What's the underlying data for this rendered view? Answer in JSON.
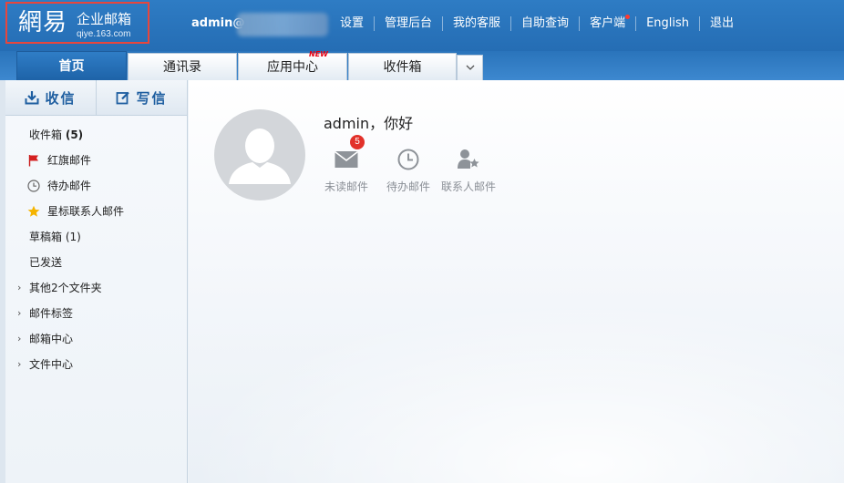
{
  "header": {
    "logo_main": "網易",
    "logo_sub": "企业邮箱",
    "logo_url": "qiye.163.com",
    "user": "admin@",
    "links": [
      "设置",
      "管理后台",
      "我的客服",
      "自助查询",
      "客户端",
      "English",
      "退出"
    ]
  },
  "tabs": [
    "首页",
    "通讯录",
    "应用中心",
    "收件箱"
  ],
  "tab_new_badge": "NEW",
  "sidebar": {
    "receive": "收信",
    "compose": "写信",
    "folders": [
      {
        "label": "收件箱",
        "count": "(5)"
      },
      {
        "label": "红旗邮件"
      },
      {
        "label": "待办邮件"
      },
      {
        "label": "星标联系人邮件"
      },
      {
        "label": "草稿箱 (1)"
      },
      {
        "label": "已发送"
      },
      {
        "label": "其他2个文件夹"
      },
      {
        "label": "邮件标签"
      },
      {
        "label": "邮箱中心"
      },
      {
        "label": "文件中心"
      }
    ]
  },
  "main": {
    "greeting": "admin，你好",
    "shortcuts": [
      {
        "label": "未读邮件",
        "badge": "5"
      },
      {
        "label": "待办邮件"
      },
      {
        "label": "联系人邮件"
      }
    ]
  },
  "colors": {
    "header_blue": "#2e7cc4",
    "accent_red": "#e2312a",
    "link_blue": "#1e5ea0"
  }
}
